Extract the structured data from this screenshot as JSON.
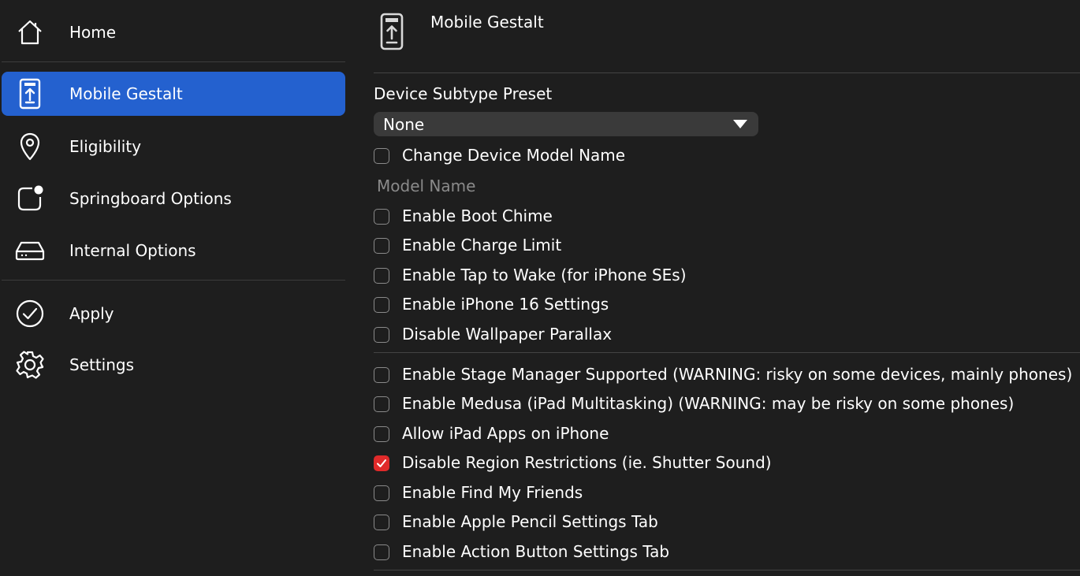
{
  "sidebar": {
    "items": [
      {
        "label": "Home",
        "icon": "home-icon"
      },
      {
        "label": "Mobile Gestalt",
        "icon": "phone-upload-icon",
        "active": true
      },
      {
        "label": "Eligibility",
        "icon": "location-pin-icon"
      },
      {
        "label": "Springboard Options",
        "icon": "app-badge-icon"
      },
      {
        "label": "Internal Options",
        "icon": "drive-icon"
      },
      {
        "label": "Apply",
        "icon": "checkmark-circle-icon"
      },
      {
        "label": "Settings",
        "icon": "gear-icon"
      }
    ]
  },
  "header": {
    "title": "Mobile Gestalt",
    "icon": "phone-upload-icon"
  },
  "preset": {
    "label": "Device Subtype Preset",
    "selected": "None"
  },
  "options": {
    "change_model_name": {
      "label": "Change Device Model Name",
      "checked": false
    },
    "model_name_placeholder": "Model Name",
    "group1": [
      {
        "label": "Enable Boot Chime",
        "checked": false
      },
      {
        "label": "Enable Charge Limit",
        "checked": false
      },
      {
        "label": "Enable Tap to Wake (for iPhone SEs)",
        "checked": false
      },
      {
        "label": "Enable iPhone 16 Settings",
        "checked": false
      },
      {
        "label": "Disable Wallpaper Parallax",
        "checked": false
      }
    ],
    "group2": [
      {
        "label": "Enable Stage Manager Supported (WARNING: risky on some devices, mainly phones)",
        "checked": false
      },
      {
        "label": "Enable Medusa (iPad Multitasking) (WARNING: may be risky on some phones)",
        "checked": false
      },
      {
        "label": "Allow iPad Apps on iPhone",
        "checked": false
      },
      {
        "label": "Disable Region Restrictions (ie. Shutter Sound)",
        "checked": true
      },
      {
        "label": "Enable Find My Friends",
        "checked": false
      },
      {
        "label": "Enable Apple Pencil Settings Tab",
        "checked": false
      },
      {
        "label": "Enable Action Button Settings Tab",
        "checked": false
      }
    ]
  },
  "colors": {
    "background": "#1e1e1e",
    "accent": "#2461cf",
    "checked": "#e02a2a",
    "muted_text": "#8a8a8a"
  }
}
